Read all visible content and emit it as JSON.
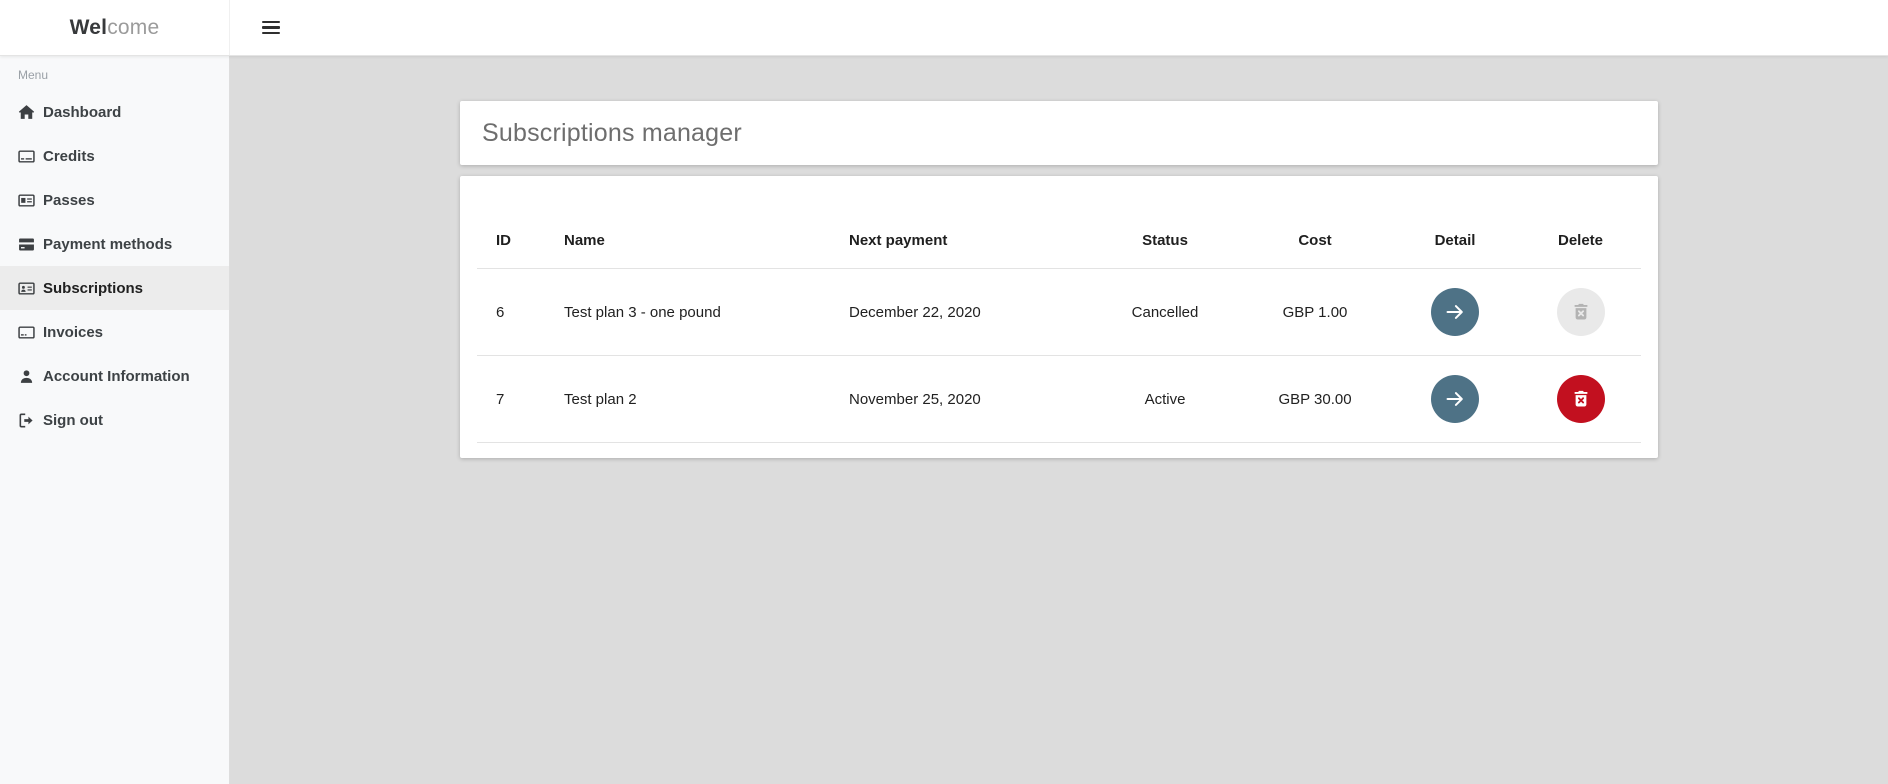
{
  "brand": {
    "bold": "Wel",
    "light": "come"
  },
  "sidebar": {
    "section_label": "Menu",
    "items": [
      {
        "label": "Dashboard",
        "icon": "home-icon",
        "active": false
      },
      {
        "label": "Credits",
        "icon": "credit-card-icon",
        "active": false
      },
      {
        "label": "Passes",
        "icon": "id-card-icon",
        "active": false
      },
      {
        "label": "Payment methods",
        "icon": "payment-card-icon",
        "active": false
      },
      {
        "label": "Subscriptions",
        "icon": "address-card-icon",
        "active": true
      },
      {
        "label": "Invoices",
        "icon": "invoice-icon",
        "active": false
      },
      {
        "label": "Account Information",
        "icon": "user-icon",
        "active": false
      },
      {
        "label": "Sign out",
        "icon": "sign-out-icon",
        "active": false
      }
    ]
  },
  "main": {
    "title": "Subscriptions manager",
    "table": {
      "columns": [
        "ID",
        "Name",
        "Next payment",
        "Status",
        "Cost",
        "Detail",
        "Delete"
      ],
      "rows": [
        {
          "id": "6",
          "name": "Test plan 3 - one pound",
          "next_payment": "December 22, 2020",
          "status": "Cancelled",
          "cost": "GBP 1.00",
          "detail_icon": "arrow-right-icon",
          "delete_icon": "trash-x-icon",
          "delete_enabled": false
        },
        {
          "id": "7",
          "name": "Test plan 2",
          "next_payment": "November 25, 2020",
          "status": "Active",
          "cost": "GBP 30.00",
          "detail_icon": "arrow-right-icon",
          "delete_icon": "trash-x-icon",
          "delete_enabled": true
        }
      ]
    }
  },
  "colors": {
    "detail_button": "#4e7286",
    "delete_button": "#c2101f",
    "delete_disabled_bg": "#e9e9e9",
    "delete_disabled_icon": "#b3b3b3",
    "content_bg": "#dcdcdc",
    "sidebar_bg": "#f8f9fa",
    "sidebar_active_bg": "#ececec"
  }
}
